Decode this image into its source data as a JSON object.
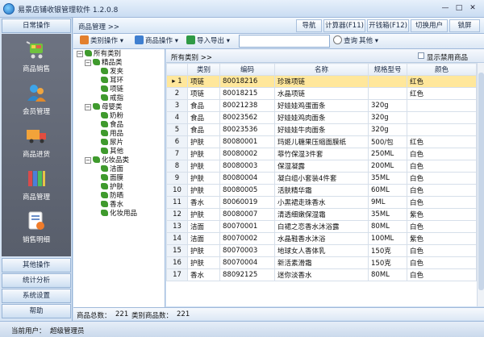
{
  "app": {
    "title": "易景店铺收银管理软件 1.2.0.8"
  },
  "window_controls": {
    "min": "—",
    "max": "□",
    "close": "✕"
  },
  "sidebar": {
    "top_header": "日常操作",
    "items": [
      {
        "label": "商品销售",
        "icon": "shopping-cart-icon"
      },
      {
        "label": "会员管理",
        "icon": "member-users-icon"
      },
      {
        "label": "商品进货",
        "icon": "delivery-truck-icon"
      },
      {
        "label": "商品管理",
        "icon": "books-icon"
      },
      {
        "label": "销售明细",
        "icon": "sales-detail-icon"
      }
    ],
    "bottom_headers": [
      "其他操作",
      "统计分析",
      "系统设置",
      "帮助"
    ]
  },
  "header": {
    "breadcrumb": "商品管理 >>",
    "buttons": [
      "导航",
      "计算器(F11)",
      "开钱箱(F12)",
      "切换用户",
      "锁屏"
    ]
  },
  "toolbar": {
    "category_ops": "类别操作",
    "product_ops": "商品操作",
    "import_export": "导入导出",
    "search_placeholder": "",
    "query": "查询",
    "other": "其他"
  },
  "tree": {
    "root": "所有类别",
    "groups": [
      {
        "label": "精品类",
        "children": [
          "发夹",
          "耳环",
          "项链",
          "戒指"
        ]
      },
      {
        "label": "母婴类",
        "children": [
          "奶粉",
          "食品",
          "用品",
          "尿片",
          "其他"
        ]
      },
      {
        "label": "化妆品类",
        "children": [
          "洁面",
          "面膜",
          "护肤",
          "防晒",
          "香水",
          "化妆用品"
        ]
      }
    ]
  },
  "grid": {
    "breadcrumb": "所有类别 >>",
    "show_disabled": "显示禁用商品",
    "columns": [
      "类别",
      "编码",
      "名称",
      "规格型号",
      "颜色"
    ],
    "rows": [
      [
        "项链",
        "80018216",
        "珍珠项链",
        "",
        "红色"
      ],
      [
        "项链",
        "80018215",
        "水晶项链",
        "",
        "红色"
      ],
      [
        "食品",
        "80021238",
        "好娃娃鸡蛋面条",
        "320g",
        ""
      ],
      [
        "食品",
        "80023562",
        "好娃娃鸡肉面条",
        "320g",
        ""
      ],
      [
        "食品",
        "80023536",
        "好娃娃牛肉面条",
        "320g",
        ""
      ],
      [
        "护肤",
        "80080001",
        "玛姬儿糖果压缩面膜纸",
        "500/包",
        "红色"
      ],
      [
        "护肤",
        "80080002",
        "菲竹保湿3件套",
        "250ML",
        "白色"
      ],
      [
        "护肤",
        "80080003",
        "保湿凝露",
        "200ML",
        "白色"
      ],
      [
        "护肤",
        "80080004",
        "凝白组小套装4件套",
        "35ML",
        "白色"
      ],
      [
        "护肤",
        "80080005",
        "活肤精华霜",
        "60ML",
        "白色"
      ],
      [
        "香水",
        "80060019",
        "小黑裙走珠香水",
        "9ML",
        "白色"
      ],
      [
        "护肤",
        "80080007",
        "清透细嫩保湿霜",
        "35ML",
        "紫色"
      ],
      [
        "洁面",
        "80070001",
        "白裙之恋香水沐浴露",
        "80ML",
        "白色"
      ],
      [
        "洁面",
        "80070002",
        "水晶鞋香水沐浴",
        "100ML",
        "紫色"
      ],
      [
        "护肤",
        "80070003",
        "地球女人香体乳",
        "150克",
        "白色"
      ],
      [
        "护肤",
        "80070004",
        "新活素滑霜",
        "150克",
        "白色"
      ],
      [
        "香水",
        "88092125",
        "迷你淡香水",
        "80ML",
        "白色"
      ]
    ]
  },
  "footer": {
    "total_label": "商品总数：",
    "total": "221",
    "cat_label": "类别商品数：",
    "cat_total": "221"
  },
  "status": {
    "user_label": "当前用户：",
    "user": "超级管理员"
  },
  "colors": {
    "accent": "#cfe0f3",
    "selected_row": "#ffe79b",
    "sidebar_panel": "#606673"
  }
}
